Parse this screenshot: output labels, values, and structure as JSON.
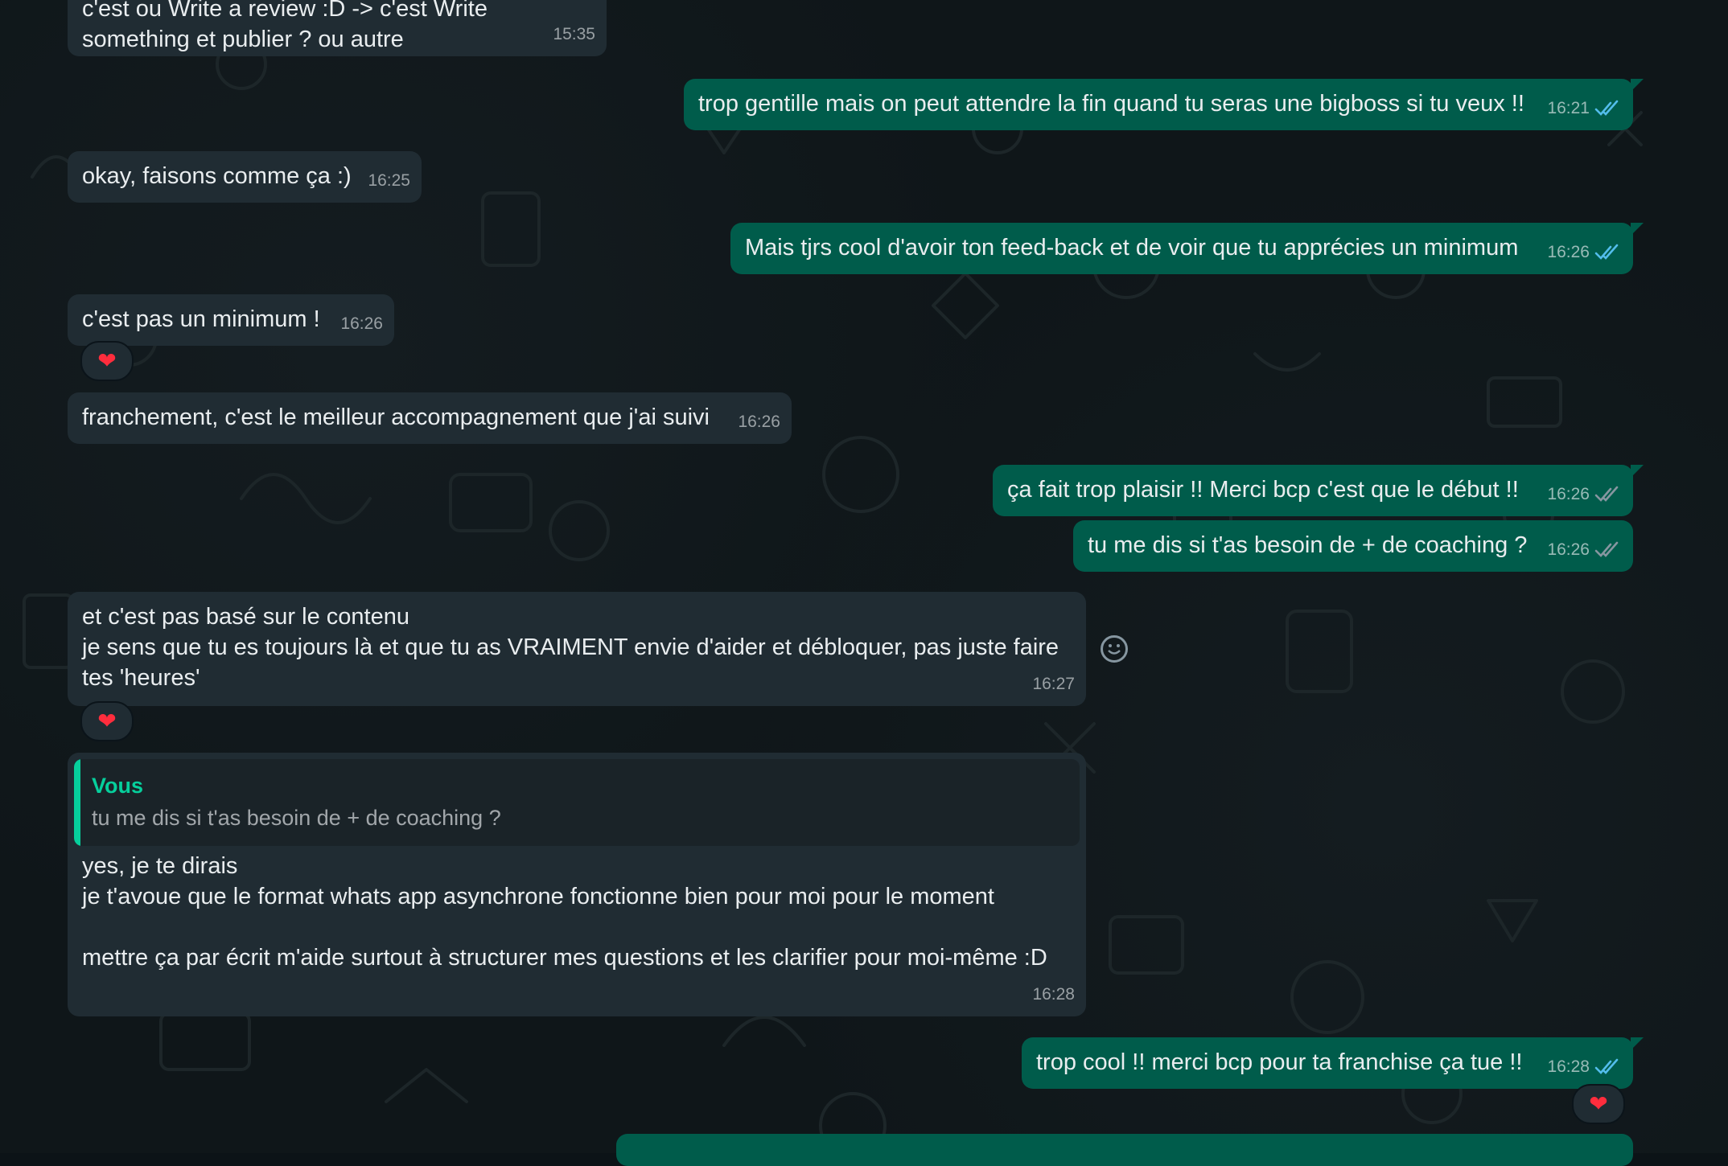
{
  "messages": [
    {
      "text": "c'est ou Write a review :D -> c'est Write\nsomething et publier ? ou autre",
      "time": "15:35"
    },
    {
      "text": "trop gentille mais on peut attendre la fin quand tu seras une bigboss si tu veux !!",
      "time": "16:21"
    },
    {
      "text": "okay, faisons comme ça :)",
      "time": "16:25"
    },
    {
      "text": "Mais tjrs cool d'avoir ton feed-back et de voir que tu apprécies un minimum",
      "time": "16:26"
    },
    {
      "text": "c'est pas un minimum !",
      "time": "16:26",
      "reaction": "❤"
    },
    {
      "text": "franchement, c'est le meilleur accompagnement que j'ai suivi",
      "time": "16:26"
    },
    {
      "text": "ça fait trop plaisir !! Merci bcp c'est que le début !!",
      "time": "16:26"
    },
    {
      "text": "tu me dis si t'as besoin de + de coaching ?",
      "time": "16:26"
    },
    {
      "text": "et c'est pas basé sur le contenu\nje sens que tu es toujours là et que tu as VRAIMENT envie d'aider et débloquer, pas juste faire\ntes 'heures'",
      "time": "16:27",
      "reaction": "❤"
    },
    {
      "quote_author": "Vous",
      "quote_text": "tu me dis si t'as besoin de + de coaching ?",
      "text": "yes, je te dirais\nje t'avoue que le format whats app asynchrone fonctionne bien pour moi pour le moment\n\nmettre ça par écrit m'aide surtout à structurer mes questions et les clarifier pour moi-même :D",
      "time": "16:28"
    },
    {
      "text": "trop cool !! merci bcp pour ta franchise ça tue !!",
      "time": "16:28",
      "reaction": "❤"
    }
  ],
  "colors": {
    "incoming": "#202c33",
    "outgoing": "#005c4b",
    "accent": "#06cf9c",
    "read_ticks": "#53bdeb"
  },
  "icons": [
    "double-check-icon",
    "heart-reaction-icon",
    "emoji-icon"
  ]
}
